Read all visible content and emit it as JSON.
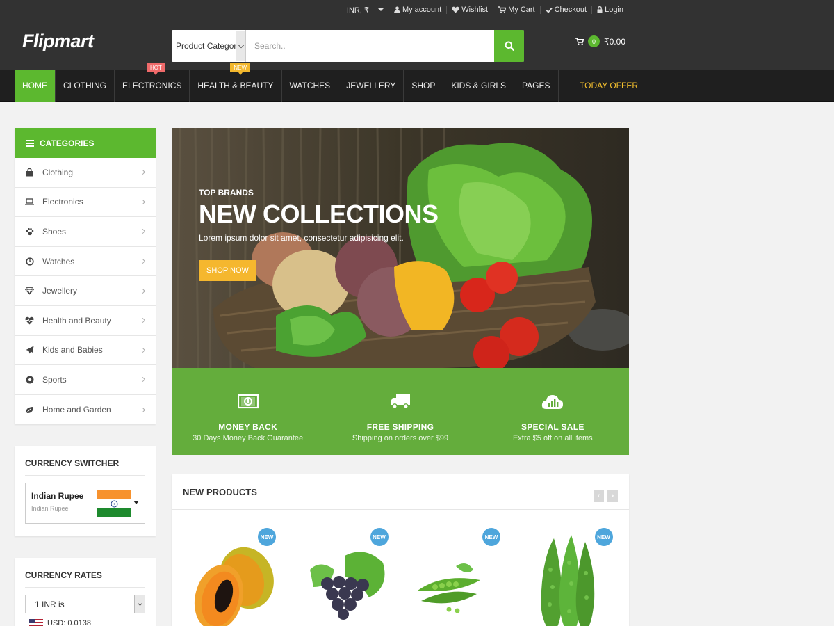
{
  "topbar": {
    "currency": "INR, ₹",
    "links": [
      "My account",
      "Wishlist",
      "My Cart",
      "Checkout",
      "Login"
    ]
  },
  "header": {
    "logo": "Flipmart",
    "search": {
      "category": "Product Category",
      "placeholder": "Search.."
    },
    "cart": {
      "count": "0",
      "total": "₹0.00"
    }
  },
  "nav": {
    "items": [
      "Home",
      "Clothing",
      "Electronics",
      "Health & Beauty",
      "Watches",
      "Jewellery",
      "Shop",
      "Kids & Girls",
      "Pages"
    ],
    "tags": {
      "hot": "HOT",
      "new": "NEW"
    },
    "today_offer": "Today Offer"
  },
  "sidebar": {
    "categories_title": "Categories",
    "categories": [
      "Clothing",
      "Electronics",
      "Shoes",
      "Watches",
      "Jewellery",
      "Health and Beauty",
      "Kids and Babies",
      "Sports",
      "Home and Garden"
    ],
    "category_icons": [
      "shopping-bag-icon",
      "laptop-icon",
      "paw-icon",
      "clock-icon",
      "diamond-icon",
      "heartbeat-icon",
      "paper-plane-icon",
      "futbol-icon",
      "leaf-icon"
    ],
    "currency_switcher": {
      "title": "Currency Switcher",
      "name": "Indian Rupee",
      "sub": "Indian Rupee"
    },
    "currency_rates": {
      "title": "Currency Rates",
      "select": "1 INR is",
      "first_rate": "USD: 0.0138"
    }
  },
  "hero": {
    "kicker": "Top Brands",
    "title": "NEW COLLECTIONS",
    "desc": "Lorem ipsum dolor sit amet, consectetur adipisicing elit.",
    "button": "Shop Now"
  },
  "features": [
    {
      "title": "Money Back",
      "sub": "30 Days Money Back Guarantee",
      "icon": "money-icon"
    },
    {
      "title": "Free Shipping",
      "sub": "Shipping on orders over $99",
      "icon": "truck-icon"
    },
    {
      "title": "Special Sale",
      "sub": "Extra $5 off on all items",
      "icon": "cloud-chart-icon"
    }
  ],
  "products": {
    "title": "New Products",
    "prev": "‹",
    "next": "›",
    "badge": "NEW",
    "items": [
      "papaya",
      "grapes",
      "peas",
      "bitter-gourd"
    ]
  },
  "colors": {
    "brand_green": "#5cb82f",
    "dark": "#323232",
    "offer_yellow": "#f5c02e",
    "badge_blue": "#4ea6dc"
  }
}
